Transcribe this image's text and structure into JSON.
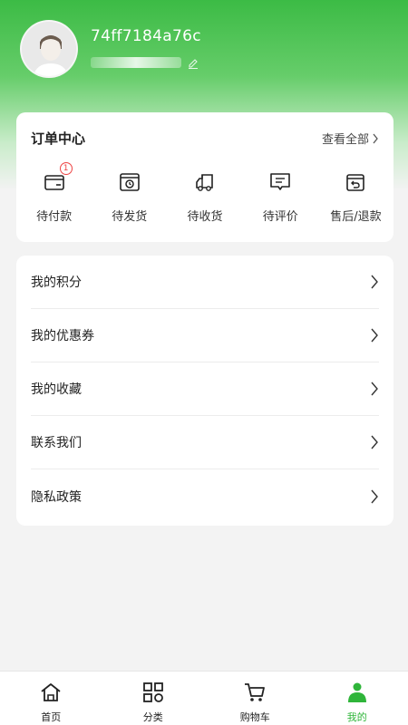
{
  "user": {
    "id": "74ff7184a76c"
  },
  "orders": {
    "title": "订单中心",
    "view_all": "查看全部",
    "items": [
      {
        "label": "待付款",
        "icon": "wallet-icon",
        "badge": "1"
      },
      {
        "label": "待发货",
        "icon": "package-icon"
      },
      {
        "label": "待收货",
        "icon": "truck-icon"
      },
      {
        "label": "待评价",
        "icon": "comment-icon"
      },
      {
        "label": "售后/退款",
        "icon": "return-icon"
      }
    ]
  },
  "menu": [
    {
      "label": "我的积分"
    },
    {
      "label": "我的优惠券"
    },
    {
      "label": "我的收藏"
    },
    {
      "label": "联系我们"
    },
    {
      "label": "隐私政策"
    }
  ],
  "tabbar": {
    "items": [
      {
        "label": "首页",
        "icon": "home-icon"
      },
      {
        "label": "分类",
        "icon": "category-icon"
      },
      {
        "label": "购物车",
        "icon": "cart-icon"
      },
      {
        "label": "我的",
        "icon": "profile-icon",
        "active": true
      }
    ]
  },
  "colors": {
    "accent": "#2fb53a",
    "header_top": "#3cbb45",
    "badge": "#e44444"
  }
}
